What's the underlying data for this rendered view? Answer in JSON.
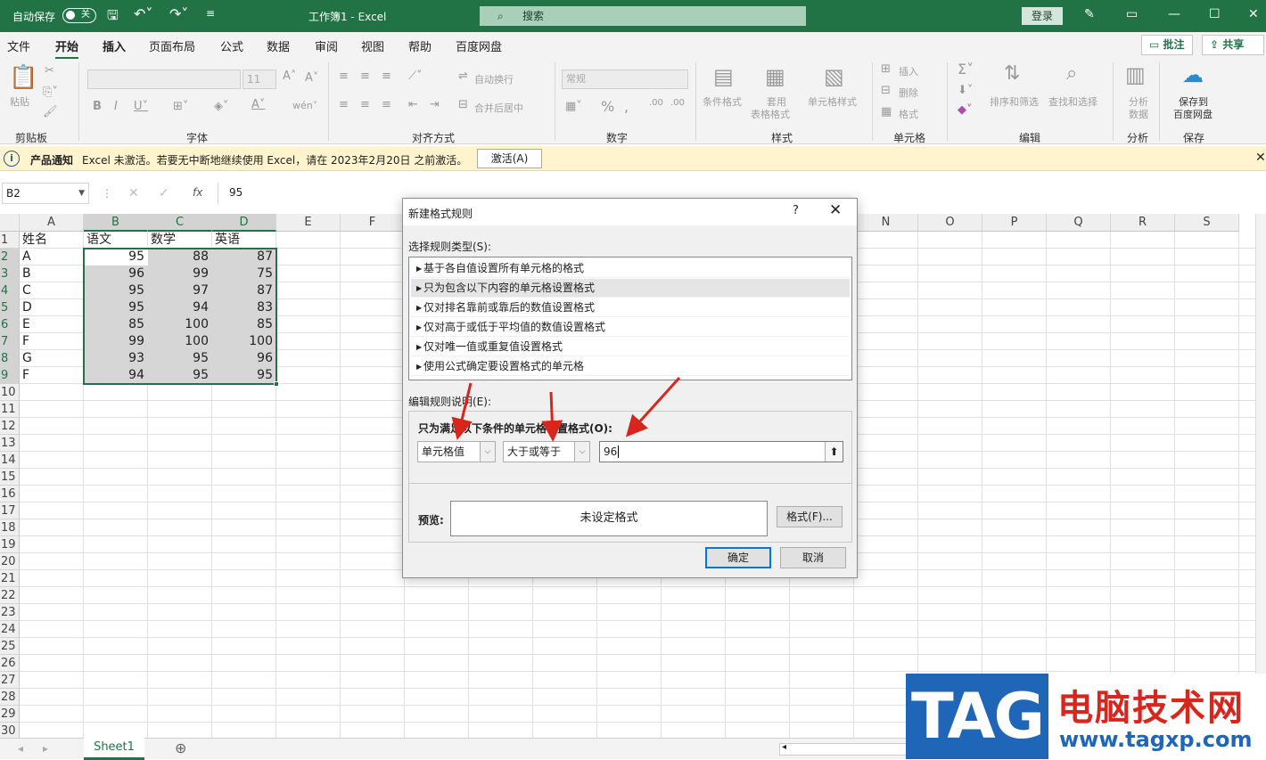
{
  "titlebar": {
    "autosave_label": "自动保存",
    "autosave_state": "关",
    "undo_icon": "undo-icon",
    "document_title": "工作簿1  -  Excel",
    "search_placeholder": "搜索",
    "login_label": "登录"
  },
  "menu": {
    "tabs": [
      "文件",
      "开始",
      "插入",
      "页面布局",
      "公式",
      "数据",
      "审阅",
      "视图",
      "帮助",
      "百度网盘"
    ],
    "comments_label": "批注",
    "share_label": "共享"
  },
  "ribbon": {
    "paste_label": "粘贴",
    "font_size": "11",
    "wrap_label": "自动换行",
    "merge_label": "合并后居中",
    "number_format": "常规",
    "cond_format_label": "条件格式",
    "table_format_label_1": "套用",
    "table_format_label_2": "表格格式",
    "cell_style_label": "单元格样式",
    "insert_label": "插入",
    "delete_label": "删除",
    "format_label": "格式",
    "sort_label": "排序和筛选",
    "find_label": "查找和选择",
    "analyze_label_1": "分析",
    "analyze_label_2": "数据",
    "save_baidu_1": "保存到",
    "save_baidu_2": "百度网盘",
    "groups": {
      "clipboard": "剪贴板",
      "font": "字体",
      "alignment": "对齐方式",
      "number": "数字",
      "styles": "样式",
      "cells": "单元格",
      "editing": "编辑",
      "analysis": "分析",
      "save": "保存"
    }
  },
  "notification": {
    "title": "产品通知",
    "message": "Excel 未激活。若要无中断地继续使用 Excel，请在 2023年2月20日 之前激活。",
    "button": "激活(A)"
  },
  "formula_bar": {
    "name_box": "B2",
    "fx": "fx",
    "value": "95"
  },
  "sheet": {
    "columns": [
      "A",
      "B",
      "C",
      "D",
      "E",
      "F",
      "G",
      "H",
      "I",
      "J",
      "K",
      "L",
      "M",
      "N",
      "O",
      "P",
      "Q",
      "R",
      "S"
    ],
    "rows": [
      "1",
      "2",
      "3",
      "4",
      "5",
      "6",
      "7",
      "8",
      "9",
      "10",
      "11",
      "12",
      "13",
      "14",
      "15",
      "16",
      "17",
      "18",
      "19",
      "20",
      "21",
      "22",
      "23",
      "24",
      "25",
      "26",
      "27",
      "28",
      "29",
      "30"
    ],
    "header_row": [
      "姓名",
      "语文",
      "数学",
      "英语"
    ],
    "data": [
      [
        "A",
        "95",
        "88",
        "87"
      ],
      [
        "B",
        "96",
        "99",
        "75"
      ],
      [
        "C",
        "95",
        "97",
        "87"
      ],
      [
        "D",
        "95",
        "94",
        "83"
      ],
      [
        "E",
        "85",
        "100",
        "85"
      ],
      [
        "F",
        "99",
        "100",
        "100"
      ],
      [
        "G",
        "93",
        "95",
        "96"
      ],
      [
        "F",
        "94",
        "95",
        "95"
      ]
    ],
    "tab_name": "Sheet1"
  },
  "dialog": {
    "title": "新建格式规则",
    "help": "?",
    "close": "✕",
    "rule_type_label": "选择规则类型(S):",
    "rule_types": [
      "基于各自值设置所有单元格的格式",
      "只为包含以下内容的单元格设置格式",
      "仅对排名靠前或靠后的数值设置格式",
      "仅对高于或低于平均值的数值设置格式",
      "仅对唯一值或重复值设置格式",
      "使用公式确定要设置格式的单元格"
    ],
    "edit_label": "编辑规则说明(E):",
    "condition_label": "只为满足以下条件的单元格设置格式(O):",
    "combo1": "单元格值",
    "combo2": "大于或等于",
    "value": "96",
    "preview_label": "预览:",
    "preview_text": "未设定格式",
    "format_button": "格式(F)...",
    "ok": "确定",
    "cancel": "取消"
  },
  "watermark": {
    "logo": "TAG",
    "site_name": "电脑技术网",
    "url": "www.tagxp.com"
  },
  "colors": {
    "excel_green": "#217346",
    "annotation_red": "#d9261c"
  }
}
